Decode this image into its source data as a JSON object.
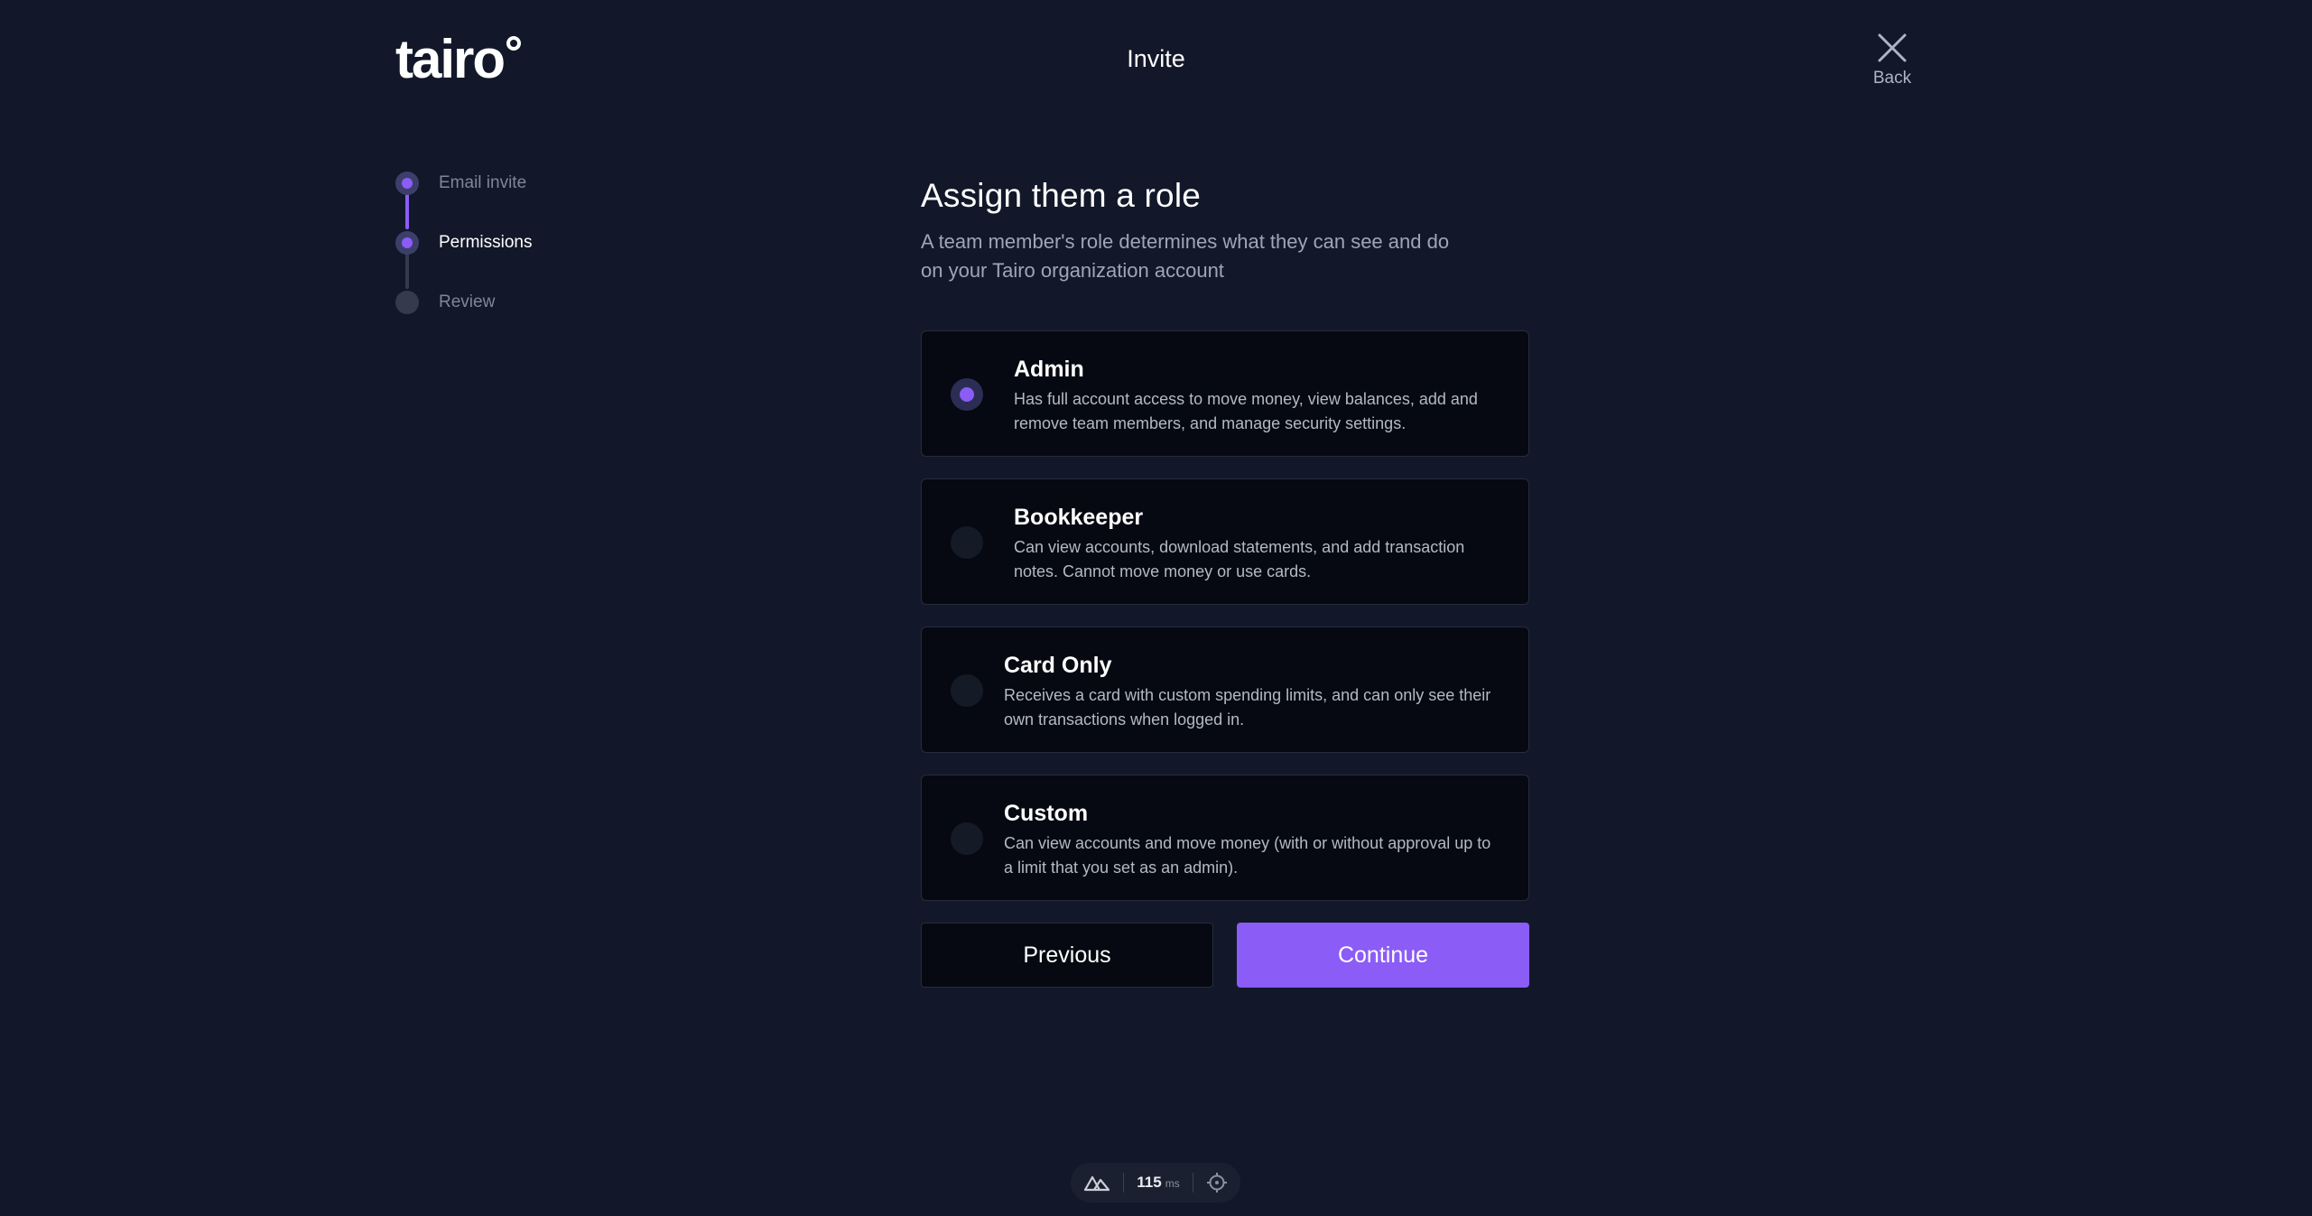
{
  "brand": {
    "logo_text": "tairo",
    "accent_color": "#8b5cf6"
  },
  "header": {
    "title": "Invite",
    "back_label": "Back",
    "back_icon": "close-icon"
  },
  "stepper": {
    "steps": [
      {
        "label": "Email invite",
        "state": "complete"
      },
      {
        "label": "Permissions",
        "state": "current"
      },
      {
        "label": "Review",
        "state": "pending"
      }
    ]
  },
  "main": {
    "heading": "Assign them a role",
    "subheading": "A team member's role determines what they can see and do on your Tairo organization account"
  },
  "roles": [
    {
      "title": "Admin",
      "description": "Has full account access to move money, view balances, add and remove team members, and manage security settings.",
      "selected": true
    },
    {
      "title": "Bookkeeper",
      "description": "Can view accounts, download statements, and add transaction notes. Cannot move money or use cards.",
      "selected": false
    },
    {
      "title": "Card Only",
      "description": "Receives a card with custom spending limits, and can only see their own transactions when logged in.",
      "selected": false
    },
    {
      "title": "Custom",
      "description": "Can view accounts and move money (with or without approval up to a limit that you set as an admin).",
      "selected": false
    }
  ],
  "actions": {
    "previous_label": "Previous",
    "continue_label": "Continue"
  },
  "devtools": {
    "render_time": "115",
    "render_unit": "ms",
    "icons": [
      "nuxt-icon",
      "crosshair-icon"
    ]
  }
}
